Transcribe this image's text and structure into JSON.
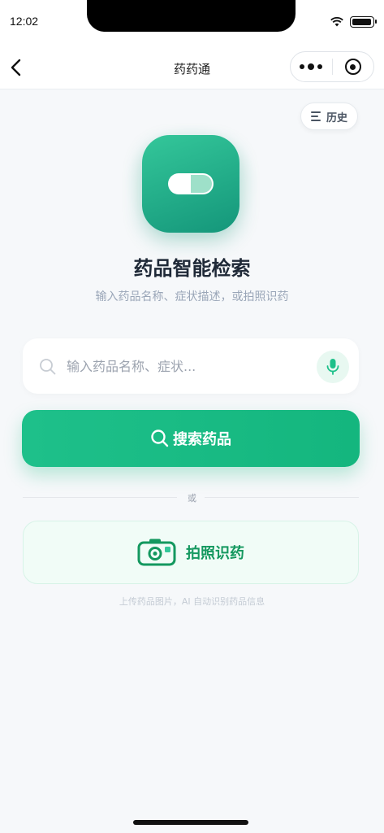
{
  "status_bar": {
    "time": "12:02"
  },
  "navbar": {
    "title": "药药通"
  },
  "history": {
    "label": "历史"
  },
  "hero": {
    "title": "药品智能检索",
    "subtitle": "输入药品名称、症状描述，或拍照识药"
  },
  "search": {
    "placeholder": "输入药品名称、症状...",
    "value": "",
    "button_label": "搜索药品"
  },
  "divider": {
    "text": "或"
  },
  "camera": {
    "label": "拍照识药",
    "hint": "上传药品图片，AI 自动识别药品信息"
  },
  "colors": {
    "accent": "#1ec08a",
    "accent_dark": "#14985f",
    "background": "#f6f8fa"
  },
  "icons": [
    "back-icon",
    "more-icon",
    "close-icon",
    "list-icon",
    "pill-icon",
    "search-icon",
    "mic-icon",
    "camera-icon",
    "wifi-icon",
    "battery-icon"
  ]
}
